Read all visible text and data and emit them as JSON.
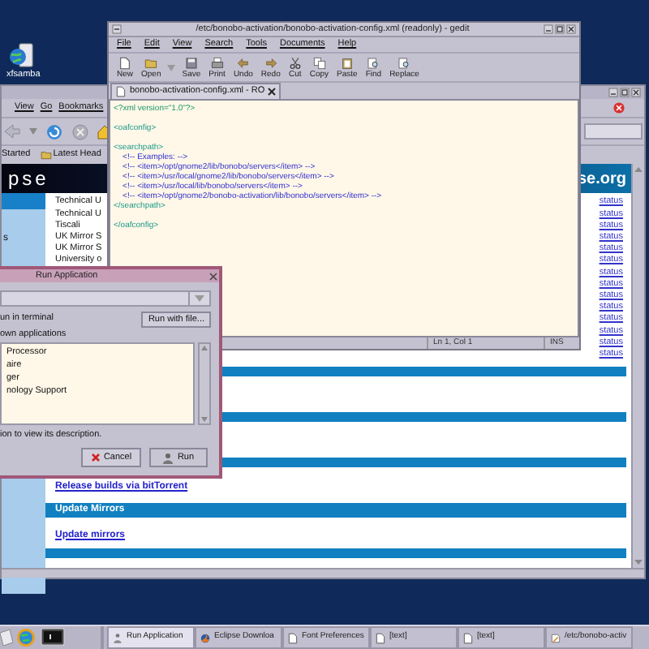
{
  "desktop_icons": [
    {
      "label": "xfsamba"
    }
  ],
  "browser": {
    "menu": [
      "View",
      "Go",
      "Bookmarks"
    ],
    "bookmarks": [
      "Started",
      "Latest Head"
    ],
    "banner": {
      "left": "pse",
      "right": "se.org"
    },
    "sidebar": {
      "items": [
        {
          "text": "s"
        }
      ]
    },
    "rows": [
      {
        "mirror": "Technical U",
        "status": "status"
      },
      {
        "mirror": "Technical U",
        "status": "status"
      },
      {
        "mirror": "Tiscali",
        "status": "status"
      },
      {
        "mirror": "UK Mirror S",
        "status": "status"
      },
      {
        "mirror": "UK Mirror S",
        "status": "status"
      },
      {
        "mirror": "University o",
        "status": "status"
      },
      {
        "status": "status"
      },
      {
        "status": "status"
      },
      {
        "status": "status"
      },
      {
        "status": "status"
      },
      {
        "status": "status"
      },
      {
        "status": "status"
      },
      {
        "status": "status"
      },
      {
        "status": "status"
      }
    ],
    "sections": [
      {
        "kind": "bar"
      },
      {
        "kind": "bar"
      },
      {
        "kind": "bar",
        "link": "Release builds via bitTorrent"
      },
      {
        "kind": "heading",
        "heading": "Update Mirrors",
        "link": "Update mirrors"
      },
      {
        "kind": "bar"
      }
    ]
  },
  "editor": {
    "title": "/etc/bonobo-activation/bonobo-activation-config.xml (readonly) - gedit",
    "menu": [
      "File",
      "Edit",
      "View",
      "Search",
      "Tools",
      "Documents",
      "Help"
    ],
    "toolbar": [
      "New",
      "Open",
      "Save",
      "Print",
      "Undo",
      "Redo",
      "Cut",
      "Copy",
      "Paste",
      "Find",
      "Replace"
    ],
    "tab": "bonobo-activation-config.xml - RO",
    "lines": [
      {
        "kind": "pi",
        "text": "<?xml version=\"1.0\"?>"
      },
      {
        "kind": "blank"
      },
      {
        "kind": "tag",
        "text": "<oafconfig>"
      },
      {
        "kind": "blank"
      },
      {
        "kind": "tag",
        "text": "<searchpath>"
      },
      {
        "kind": "comment",
        "text": "    <!-- Examples: -->"
      },
      {
        "kind": "comment",
        "text": "    <!-- <item>/opt/gnome2/lib/bonobo/servers</item> -->"
      },
      {
        "kind": "comment",
        "text": "    <!-- <item>/usr/local/gnome2/lib/bonobo/servers</item> -->"
      },
      {
        "kind": "comment",
        "text": "    <!-- <item>/usr/local/lib/bonobo/servers</item> -->"
      },
      {
        "kind": "comment",
        "text": "    <!-- <item>/opt/gnome2/bonobo-activation/lib/bonobo/servers</item> -->"
      },
      {
        "kind": "tag",
        "text": "</searchpath>"
      },
      {
        "kind": "blank"
      },
      {
        "kind": "tag",
        "text": "</oafconfig>"
      }
    ],
    "status": [
      "Ln 1, Col 1",
      "INS"
    ]
  },
  "dialog": {
    "title": "Run Application",
    "run_in_terminal": "un in terminal",
    "run_with_file": "Run with file...",
    "list_label": "own applications",
    "apps": [
      "Processor",
      "aire",
      "ger",
      "nology Support"
    ],
    "hint": "ion to view its description.",
    "cancel": "Cancel",
    "run": "Run"
  },
  "taskbar": {
    "tasks": [
      {
        "label": "Run Application",
        "selected": true
      },
      {
        "label": "Eclipse Downloa",
        "selected": false
      },
      {
        "label": "Font Preferences",
        "selected": false
      },
      {
        "label": "[text]",
        "selected": false
      },
      {
        "label": "[text]",
        "selected": false
      },
      {
        "label": "/etc/bonobo-activ",
        "selected": false
      }
    ]
  }
}
